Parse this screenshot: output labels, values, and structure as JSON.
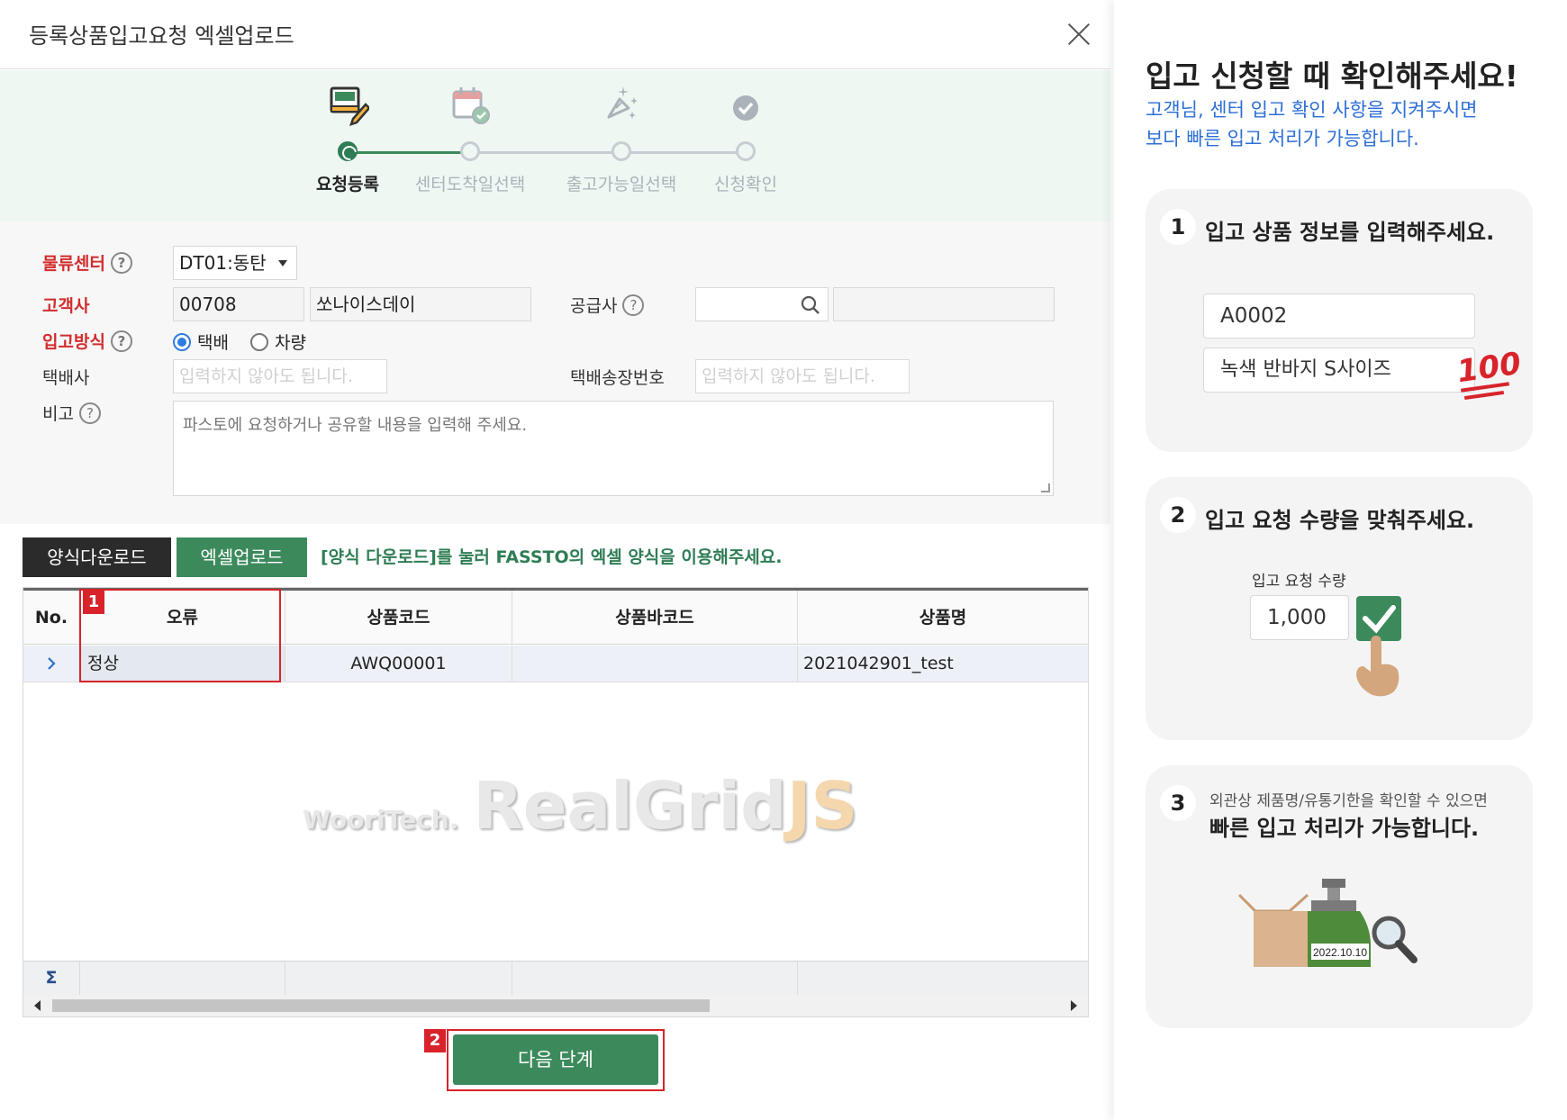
{
  "modal": {
    "title": "등록상품입고요청 엑셀업로드",
    "steps": [
      {
        "label": "요청등록",
        "icon": "memo-edit-icon",
        "state": "active"
      },
      {
        "label": "센터도착일선택",
        "icon": "calendar-check-icon",
        "state": "pending"
      },
      {
        "label": "출고가능일선택",
        "icon": "rocket-sparkle-icon",
        "state": "pending"
      },
      {
        "label": "신청확인",
        "icon": "check-circle-icon",
        "state": "pending"
      }
    ],
    "form": {
      "center_label": "물류센터",
      "center_value": "DT01:동탄",
      "customer_label": "고객사",
      "customer_code": "00708",
      "customer_name": "쏘나이스데이",
      "supplier_label": "공급사",
      "supplier_value": "",
      "supplier_name": "",
      "method_label": "입고방식",
      "method_options": [
        "택배",
        "차량"
      ],
      "method_selected": "택배",
      "courier_label": "택배사",
      "courier_placeholder": "입력하지 않아도 됩니다.",
      "tracking_label": "택배송장번호",
      "tracking_placeholder": "입력하지 않아도 됩니다.",
      "memo_label": "비고",
      "memo_placeholder": "파스토에 요청하거나 공유할 내용을 입력해 주세요."
    },
    "buttons": {
      "template_download": "양식다운로드",
      "excel_upload": "엑셀업로드",
      "hint": "[양식 다운로드]를 눌러 FASSTO의 엑셀 양식을 이용해주세요.",
      "next": "다음 단계"
    },
    "grid": {
      "columns": [
        "No.",
        "오류",
        "상품코드",
        "상품바코드",
        "상품명"
      ],
      "rows": [
        {
          "no_icon": "chevron-right-icon",
          "error": "정상",
          "code": "AWQ00001",
          "barcode": "",
          "name": "2021042901_test"
        }
      ],
      "footer_symbol": "Σ",
      "watermark_small": "WooriTech.",
      "watermark_main": "RealGrid",
      "watermark_js": "JS"
    },
    "callouts": [
      "1",
      "2"
    ],
    "colors": {
      "accent_green": "#3c8a5c",
      "required_red": "#d22d2d",
      "callout_red": "#d8232a",
      "link_blue": "#2d6fd6"
    }
  },
  "panel": {
    "title": "입고 신청할 때 확인해주세요!",
    "subtitle_line1": "고객님, 센터 입고 확인 사항을 지켜주시면",
    "subtitle_line2": "보다 빠른 입고 처리가 가능합니다.",
    "card1": {
      "num": "1",
      "title": "입고 상품 정보를 입력해주세요.",
      "mock_code": "A0002",
      "mock_name": "녹색 반바지 S사이즈",
      "badge": "100"
    },
    "card2": {
      "num": "2",
      "title": "입고 요청 수량을 맞춰주세요.",
      "qty_label": "입고 요청 수량",
      "qty_value": "1,000"
    },
    "card3": {
      "num": "3",
      "line1": "외관상 제품명/유통기한을 확인할 수 있으면",
      "line2": "빠른 입고 처리가 가능합니다.",
      "date_label": "2022.10.10"
    }
  }
}
